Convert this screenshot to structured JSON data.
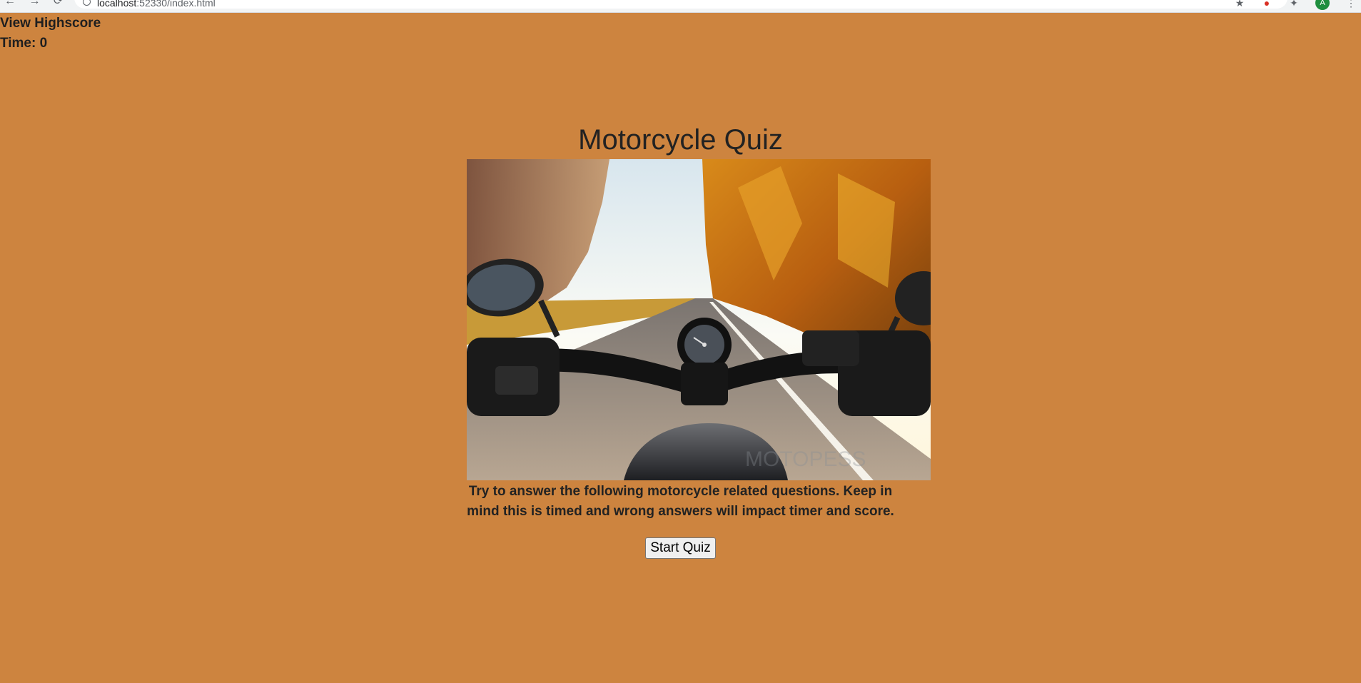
{
  "browser": {
    "url_host": "localhost",
    "url_rest": ":52330/index.html",
    "avatar_letter": "A"
  },
  "header": {
    "highscore_link": "View Highscore",
    "timer_text": "Time: 0"
  },
  "main": {
    "title": "Motorcycle Quiz",
    "hero_image_watermark": "MOTOPESS",
    "description": "Try to answer the following motorcycle related questions. Keep in mind this is timed and wrong answers will impact timer and score.",
    "start_button": "Start Quiz"
  },
  "colors": {
    "page_background": "#cd843f",
    "text": "#222222"
  }
}
